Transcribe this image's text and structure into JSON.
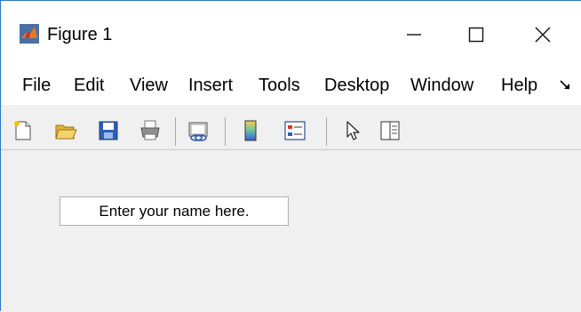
{
  "window": {
    "title": "Figure 1",
    "controls": {
      "minimize": "—",
      "maximize": "☐",
      "close": "✕"
    }
  },
  "menubar": {
    "items": [
      "File",
      "Edit",
      "View",
      "Insert",
      "Tools",
      "Desktop",
      "Window",
      "Help"
    ],
    "overflow_icon": "more-arrow-icon"
  },
  "toolbar": {
    "buttons": [
      "new-figure-icon",
      "open-file-icon",
      "save-icon",
      "print-icon",
      "link-plot-icon",
      "colorbar-icon",
      "legend-icon",
      "pointer-icon",
      "property-inspector-icon"
    ]
  },
  "content": {
    "textfield_value": "Enter your name here."
  },
  "colors": {
    "window_bg": "#f0f0f0",
    "titlebar_bg": "#ffffff",
    "border_accent": "#2b78c5"
  }
}
